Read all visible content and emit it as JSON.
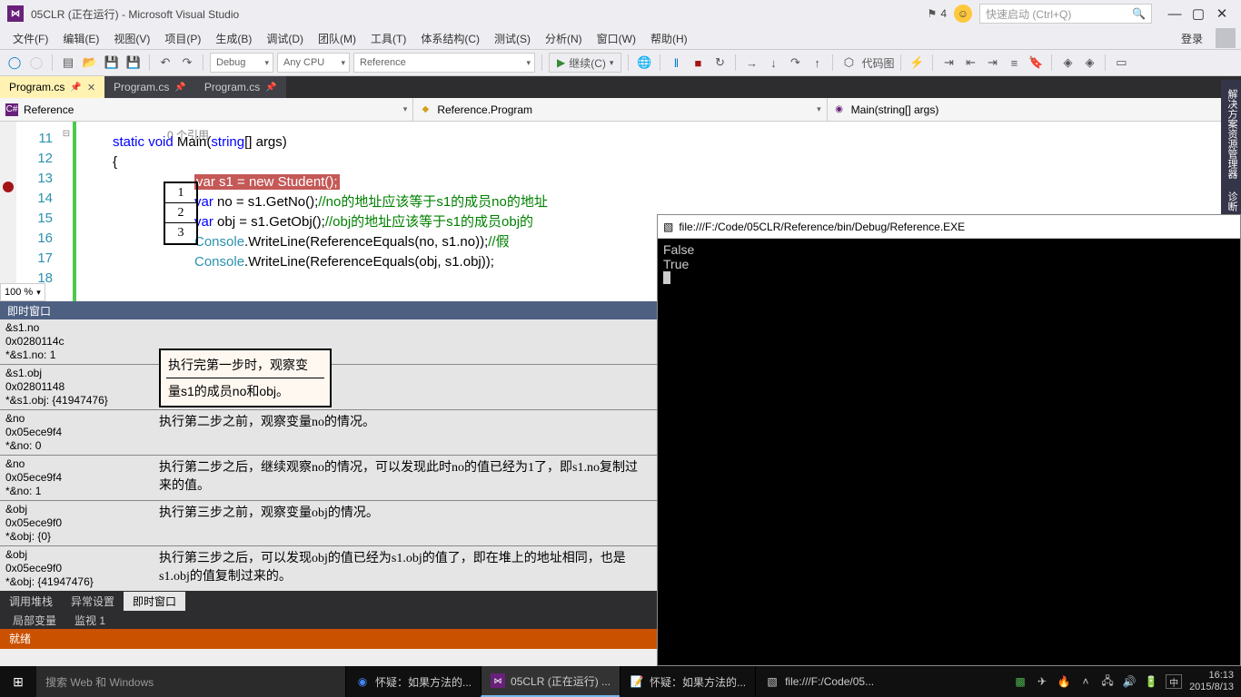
{
  "title": "05CLR (正在运行) - Microsoft Visual Studio",
  "flagCount": "4",
  "quickLaunch": "快速启动 (Ctrl+Q)",
  "menu": [
    "文件(F)",
    "编辑(E)",
    "视图(V)",
    "项目(P)",
    "生成(B)",
    "调试(D)",
    "团队(M)",
    "工具(T)",
    "体系结构(C)",
    "测试(S)",
    "分析(N)",
    "窗口(W)",
    "帮助(H)"
  ],
  "login": "登录",
  "toolbar": {
    "config": "Debug",
    "platform": "Any CPU",
    "startup": "Reference",
    "continue": "继续(C)",
    "codemap": "代码图"
  },
  "tabs": [
    {
      "label": "Program.cs",
      "active": true,
      "pinned": true
    },
    {
      "label": "Program.cs",
      "active": false,
      "pinned": true
    },
    {
      "label": "Program.cs",
      "active": false,
      "pinned": true
    }
  ],
  "nav": {
    "left": "Reference",
    "mid": "Reference.Program",
    "right": "Main(string[] args)"
  },
  "sideTabs": [
    "解决方案资源管理器",
    "诊断"
  ],
  "code": {
    "refCount": "0 个引用",
    "lines": [
      "11",
      "12",
      "13",
      "14",
      "15",
      "16",
      "17",
      "18"
    ],
    "l11a": "static",
    "l11b": "void",
    "l11c": " Main(",
    "l11d": "string",
    "l11e": "[] args)",
    "l12": "{",
    "l13a": "var",
    "l13b": " s1 = ",
    "l13c": "new",
    "l13d": " ",
    "l13e": "Student",
    "l13f": "();",
    "l14a": "var",
    "l14b": " no = s1.GetNo();",
    "l14c": "//no的地址应该等于s1的成员no的地址",
    "l15a": "var",
    "l15b": " obj = s1.GetObj();",
    "l15c": "//obj的地址应该等于s1的成员obj的",
    "l16a": "Console",
    "l16b": ".WriteLine(ReferenceEquals(no, s1.no));",
    "l16c": "//假",
    "l17a": "Console",
    "l17b": ".WriteLine(ReferenceEquals(obj, s1.obj));",
    "steps": [
      "1",
      "2",
      "3"
    ],
    "zoom": "100 %"
  },
  "immediate": {
    "title": "即时窗口",
    "b1": [
      "&s1.no",
      "0x0280114c",
      "    *&s1.no: 1"
    ],
    "b2": [
      "&s1.obj",
      "0x02801148",
      "    *&s1.obj: {41947476}"
    ],
    "b3": [
      "&no",
      "0x05ece9f4",
      "    *&no: 0"
    ],
    "b4": [
      "&no",
      "0x05ece9f4",
      "    *&no: 1"
    ],
    "b5": [
      "&obj",
      "0x05ece9f0",
      "    *&obj: {0}"
    ],
    "b6": [
      "&obj",
      "0x05ece9f0",
      "    *&obj: {41947476}"
    ],
    "a1a": "执行完第一步时，观察变",
    "a1b": "量s1的成员no和obj。",
    "a3": "执行第二步之前，观察变量no的情况。",
    "a4": "执行第二步之后，继续观察no的情况，可以发现此时no的值已经为1了，即s1.no复制过来的值。",
    "a5": "执行第三步之前，观察变量obj的情况。",
    "a6": "执行第三步之后，可以发现obj的值已经为s1.obj的值了，即在堆上的地址相同，也是s1.obj的值复制过来的。"
  },
  "bottomTabs1": [
    "调用堆栈",
    "异常设置",
    "即时窗口"
  ],
  "bottomTabs2": [
    "局部变量",
    "监视 1"
  ],
  "status": "就绪",
  "console": {
    "title": "file:///F:/Code/05CLR/Reference/bin/Debug/Reference.EXE",
    "out": [
      "False",
      "True"
    ]
  },
  "taskbar": {
    "search": "搜索 Web 和 Windows",
    "items": [
      {
        "label": "怀疑：如果方法的..."
      },
      {
        "label": "05CLR (正在运行) ..."
      },
      {
        "label": "怀疑：如果方法的..."
      },
      {
        "label": "file:///F:/Code/05..."
      }
    ],
    "time": "16:13",
    "date": "2015/8/13",
    "ime": "中"
  }
}
